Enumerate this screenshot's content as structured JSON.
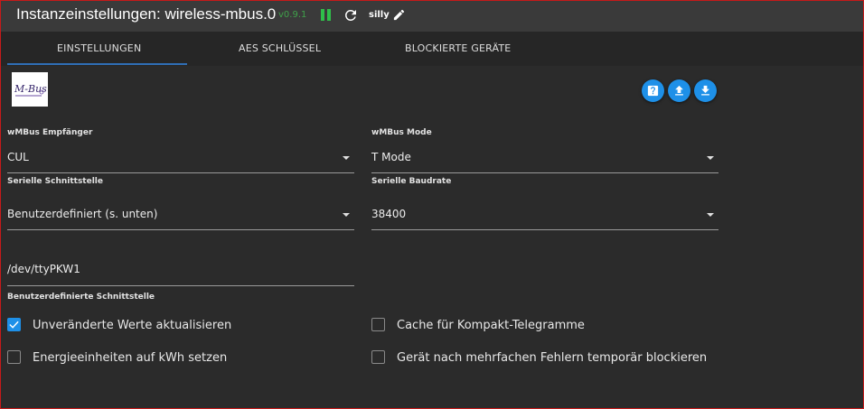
{
  "header": {
    "title": "Instanzeinstellungen: wireless-mbus.0",
    "version": "v0.9.1",
    "log_level": "silly",
    "icons": [
      "pause-icon",
      "reload-icon",
      "pencil-icon"
    ]
  },
  "tabs": [
    {
      "label": "EINSTELLUNGEN",
      "active": true
    },
    {
      "label": "AES SCHLÜSSEL",
      "active": false
    },
    {
      "label": "BLOCKIERTE GERÄTE",
      "active": false
    }
  ],
  "logo_text": "M-Bus",
  "toolbar_icons": [
    "help-icon",
    "upload-icon",
    "download-icon"
  ],
  "fields": {
    "receiver": {
      "label": "wMBus Empfänger",
      "value": "CUL"
    },
    "mode": {
      "label": "wMBus Mode",
      "value": "T Mode"
    },
    "serial_interface": {
      "label": "Serielle Schnittstelle",
      "value": "Benutzerdefiniert (s. unten)"
    },
    "baudrate": {
      "label": "Serielle Baudrate",
      "value": "38400"
    },
    "custom_interface": {
      "label": "Benutzerdefinierte Schnittstelle",
      "value": "/dev/ttyPKW1"
    }
  },
  "checkboxes": {
    "update_unchanged": {
      "label": "Unveränderte Werte aktualisieren",
      "checked": true
    },
    "compact_cache": {
      "label": "Cache für Kompakt-Telegramme",
      "checked": false
    },
    "energy_kwh": {
      "label": "Energieeinheiten auf kWh setzen",
      "checked": false
    },
    "block_device": {
      "label": "Gerät nach mehrfachen Fehlern temporär blockieren",
      "checked": false
    }
  },
  "colors": {
    "accent": "#1e90e8",
    "background": "#2b2b2b",
    "header": "#3a3a3a",
    "tabbar": "#262626",
    "version": "#3fa14a",
    "pause": "#2fbf4a"
  }
}
